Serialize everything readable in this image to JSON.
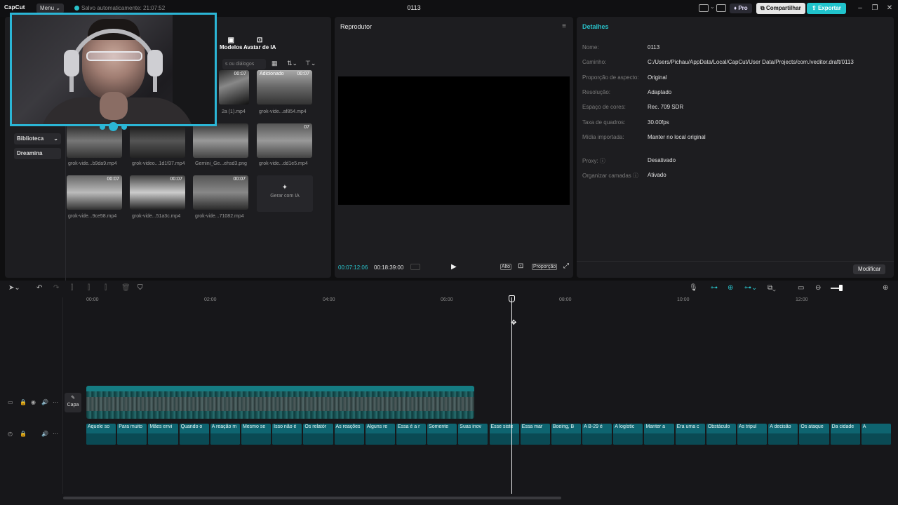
{
  "titlebar": {
    "logo": "CapCut",
    "menu": "Menu ⌄",
    "autosave": "Salvo automaticamente: 21:07:52",
    "project": "0113",
    "pro": "Pro",
    "share": "Compartilhar",
    "export": "Exportar"
  },
  "media": {
    "tabs": [
      "Modelos",
      "Avatar de IA"
    ],
    "search_placeholder": "s ou diálogos",
    "side": [
      "Biblioteca",
      "Dreamina"
    ],
    "added_label": "Adicionado",
    "items": [
      {
        "name": "2a (1).mp4",
        "dur": "00:07"
      },
      {
        "name": "grok-vide...af854.mp4",
        "dur": "00:07"
      },
      {
        "name": "grok-vide...b9da9.mp4",
        "dur": ""
      },
      {
        "name": "grok-video...1d1f37.mp4",
        "dur": ""
      },
      {
        "name": "Gemini_Ge...ehsd3.png",
        "dur": ""
      },
      {
        "name": "grok-vide...dd1e5.mp4",
        "dur": "07"
      },
      {
        "name": "grok-vide...9ce58.mp4",
        "dur": "00:07"
      },
      {
        "name": "grok-vide...51a3c.mp4",
        "dur": "00:07"
      },
      {
        "name": "grok-vide...71082.mp4",
        "dur": "00:07"
      }
    ],
    "generate": "Gerar com IA"
  },
  "player": {
    "title": "Reprodutor",
    "current": "00:07:12:06",
    "total": "00:18:39:00",
    "ctl_quality": "Alto",
    "ctl_ratio": "Proporção"
  },
  "details": {
    "title": "Detalhes",
    "rows": [
      {
        "label": "Nome:",
        "value": "0113"
      },
      {
        "label": "Caminho:",
        "value": "C:/Users/Pichau/AppData/Local/CapCut/User Data/Projects/com.lveditor.draft/0113"
      },
      {
        "label": "Proporção de aspecto:",
        "value": "Original"
      },
      {
        "label": "Resolução:",
        "value": "Adaptado"
      },
      {
        "label": "Espaço de cores:",
        "value": "Rec. 709 SDR"
      },
      {
        "label": "Taxa de quadros:",
        "value": "30.00fps"
      },
      {
        "label": "Mídia importada:",
        "value": "Manter no local original"
      },
      {
        "label": "Proxy: ⓘ",
        "value": "Desativado"
      },
      {
        "label": "Organizar camadas ⓘ",
        "value": "Ativado"
      }
    ],
    "modify": "Modificar"
  },
  "timeline": {
    "ticks": [
      "00:00",
      "02:00",
      "04:00",
      "06:00",
      "08:00",
      "10:00",
      "12:00"
    ],
    "cover": "Capa",
    "subtitles": [
      "Aquele so",
      "Para muito",
      "Mães envi",
      "Quando o",
      "A reação m",
      "Mesmo se",
      "Isso não é",
      "Os relatór",
      "As reações",
      "Alguns re",
      "Essa é a r",
      "Somente",
      "Suas inov",
      "Esse siste",
      "Essa mar",
      "Boeing, B",
      "A B-29 é",
      "A logístic",
      "Manter a",
      "Era uma c",
      "Obstáculo",
      "As tripul",
      "A decisão",
      "Os ataque",
      "Da cidade",
      "A"
    ]
  }
}
